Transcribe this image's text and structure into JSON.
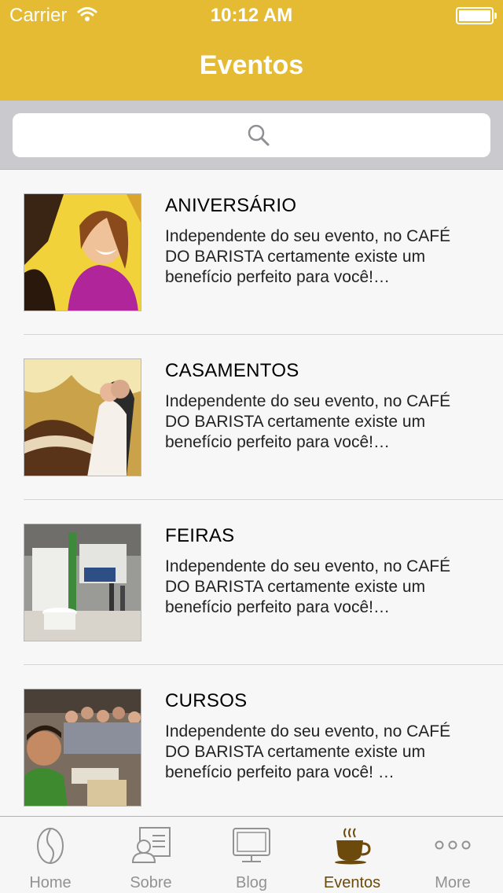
{
  "status_bar": {
    "carrier": "Carrier",
    "time": "10:12 AM"
  },
  "nav": {
    "title": "Eventos"
  },
  "search": {
    "placeholder": ""
  },
  "events": [
    {
      "title": "ANIVERSÁRIO",
      "description": "Independente do seu evento, no CAFÉ DO BARISTA certamente existe um benefício perfeito para você!…",
      "image": "birthday-photo"
    },
    {
      "title": "CASAMENTOS",
      "description": "Independente do seu evento, no CAFÉ DO BARISTA certamente existe um benefício perfeito para você!…",
      "image": "wedding-photo"
    },
    {
      "title": "FEIRAS",
      "description": "Independente do seu evento, no CAFÉ DO BARISTA certamente existe um benefício perfeito para você!…",
      "image": "fair-photo"
    },
    {
      "title": "CURSOS",
      "description": "Independente do seu evento, no CAFÉ DO BARISTA certamente existe um benefício perfeito para você! …",
      "image": "course-photo"
    }
  ],
  "tabs": [
    {
      "label": "Home",
      "icon": "coffee-bean-icon",
      "active": false
    },
    {
      "label": "Sobre",
      "icon": "profile-card-icon",
      "active": false
    },
    {
      "label": "Blog",
      "icon": "monitor-icon",
      "active": false
    },
    {
      "label": "Eventos",
      "icon": "coffee-cup-icon",
      "active": true
    },
    {
      "label": "More",
      "icon": "more-icon",
      "active": false
    }
  ],
  "colors": {
    "brand": "#e5bb33",
    "active_tab": "#6b4a0b",
    "inactive_tab": "#929292"
  }
}
